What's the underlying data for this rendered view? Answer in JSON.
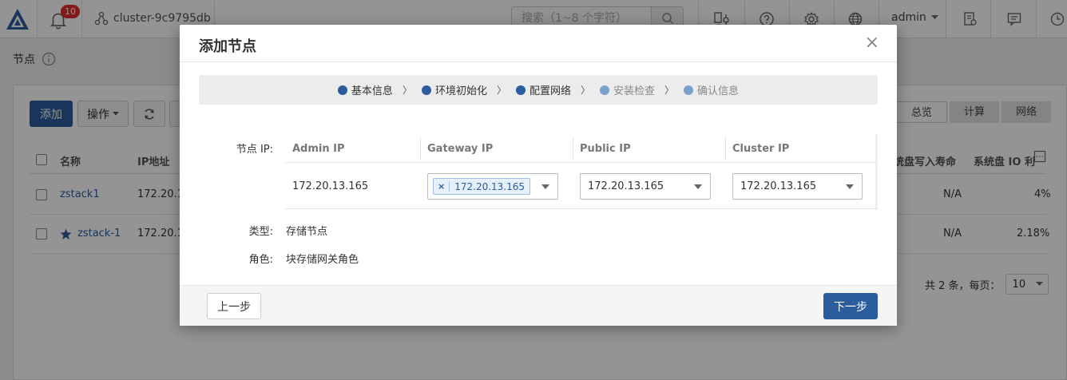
{
  "topbar": {
    "notification_count": "10",
    "cluster_name": "cluster-9c9795db",
    "search_placeholder": "搜索（1~8 个字符）",
    "user": "admin"
  },
  "page": {
    "title": "节点",
    "toolbar": {
      "add_label": "添加",
      "operate_label": "操作"
    },
    "tabs": [
      {
        "label": "总览"
      },
      {
        "label": "计算"
      },
      {
        "label": "网络"
      }
    ],
    "table": {
      "headers": [
        "名称",
        "IP地址",
        "统盘写入寿命",
        "系统盘 IO 利"
      ],
      "rows": [
        {
          "name": "zstack1",
          "ip": "172.20.1",
          "endurance": "N/A",
          "io": "4%"
        },
        {
          "name": "zstack-1",
          "ip": "172.20.1",
          "endurance": "N/A",
          "io": "2.18%"
        }
      ]
    },
    "pager": {
      "total_text": "共 2 条，每页：",
      "page_size": "10"
    }
  },
  "modal": {
    "title": "添加节点",
    "steps": [
      {
        "label": "基本信息",
        "state": "done"
      },
      {
        "label": "环境初始化",
        "state": "done"
      },
      {
        "label": "配置网络",
        "state": "active"
      },
      {
        "label": "安装检查",
        "state": "pending"
      },
      {
        "label": "确认信息",
        "state": "pending"
      }
    ],
    "node_ip_label": "节点 IP:",
    "ip_table": {
      "headers": {
        "admin": "Admin IP",
        "gateway": "Gateway IP",
        "public": "Public IP",
        "cluster": "Cluster IP"
      },
      "admin_ip": "172.20.13.165",
      "gateway_ip_tag": "172.20.13.165",
      "gateway_tag_remove": "×",
      "public_ip": "172.20.13.165",
      "cluster_ip": "172.20.13.165"
    },
    "type_label": "类型:",
    "type_value": "存储节点",
    "role_label": "角色:",
    "role_value": "块存储网关角色",
    "prev_label": "上一步",
    "next_label": "下一步",
    "close_symbol": "×"
  },
  "colors": {
    "primary": "#2b5c9e",
    "badge": "#e02d2d",
    "pending_dot": "#7aa0cc"
  }
}
